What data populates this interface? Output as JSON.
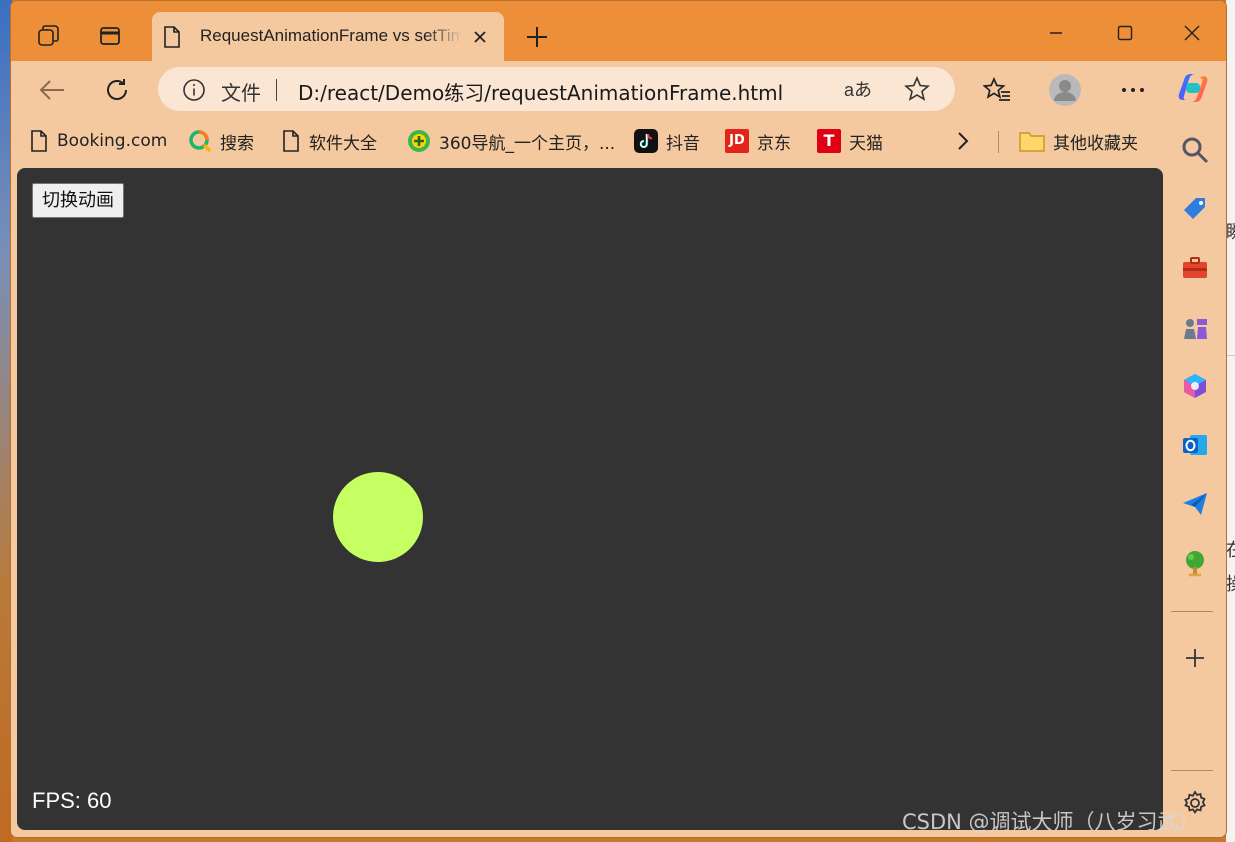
{
  "browser": {
    "tab": {
      "title": "RequestAnimationFrame vs setTimeout"
    },
    "address": {
      "scheme_label": "文件",
      "url": "D:/react/Demo练习/requestAnimationFrame.html",
      "read_aloud": "aあ"
    },
    "bookmarks": [
      {
        "label": "Booking.com",
        "icon": "page-icon"
      },
      {
        "label": "搜索",
        "icon": "search-q-icon"
      },
      {
        "label": "软件大全",
        "icon": "page-icon"
      },
      {
        "label": "360导航_一个主页，...",
        "icon": "360-icon"
      },
      {
        "label": "抖音",
        "icon": "douyin-icon"
      },
      {
        "label": "京东",
        "icon": "jd-icon"
      },
      {
        "label": "天猫",
        "icon": "tmall-icon"
      }
    ],
    "other_bookmarks": "其他收藏夹",
    "jd_glyph": "JD",
    "tmall_glyph": "T"
  },
  "page": {
    "toggle_button": "切换动画",
    "fps_label": "FPS: 60",
    "ball_color": "#c5ff62",
    "background": "#333333"
  },
  "desktop": {
    "right_fragments": [
      "瞬",
      "在",
      "操"
    ]
  },
  "watermark": "CSDN @调试大师（八岁习武）"
}
